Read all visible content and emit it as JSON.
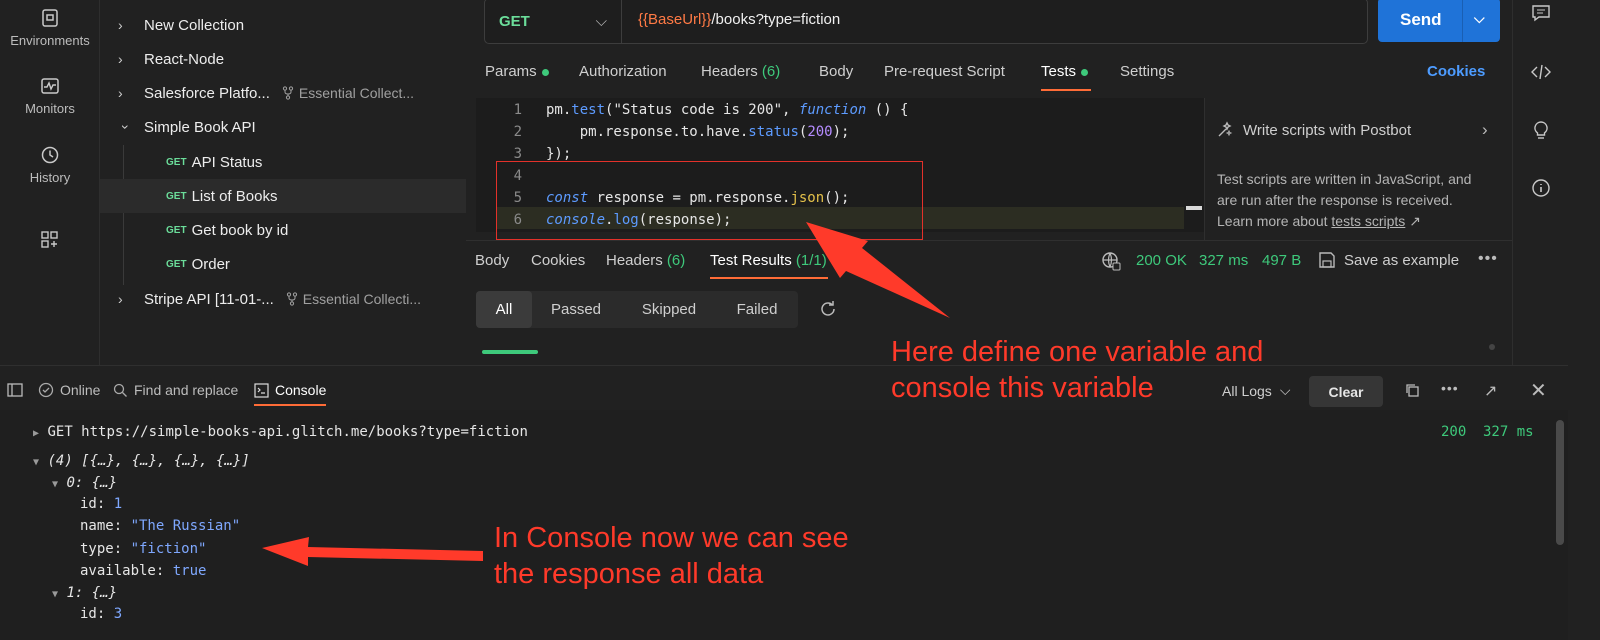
{
  "left_rail": {
    "environments": "Environments",
    "monitors": "Monitors",
    "history": "History"
  },
  "collections": [
    {
      "label": "New Collection",
      "fork": ""
    },
    {
      "label": "React-Node",
      "fork": ""
    },
    {
      "label": "Salesforce Platfo...",
      "fork": "Essential Collect..."
    },
    {
      "label": "Simple Book API",
      "fork": ""
    },
    {
      "label": "Stripe API [11-01-...",
      "fork": "Essential Collecti..."
    }
  ],
  "requests": [
    {
      "method": "GET",
      "label": "API Status"
    },
    {
      "method": "GET",
      "label": "List of Books"
    },
    {
      "method": "GET",
      "label": "Get book by id"
    },
    {
      "method": "GET",
      "label": "Order"
    }
  ],
  "request": {
    "method": "GET",
    "url_var": "{{BaseUrl}}",
    "url_path": "/books?type=fiction",
    "send": "Send"
  },
  "req_tabs": {
    "params": "Params",
    "authorization": "Authorization",
    "headers": "Headers",
    "headers_count": "(6)",
    "body": "Body",
    "prerequest": "Pre-request Script",
    "tests": "Tests",
    "settings": "Settings",
    "cookies": "Cookies"
  },
  "code": {
    "line_numbers": [
      "1",
      "2",
      "3",
      "4",
      "5",
      "6"
    ]
  },
  "postbot": {
    "title": "Write scripts with Postbot",
    "desc1": "Test scripts are written in JavaScript, and",
    "desc2": "are run after the response is received.",
    "desc3": "Learn more about ",
    "link": "tests scripts",
    "link_arrow": "↗"
  },
  "resp_tabs": {
    "body": "Body",
    "cookies": "Cookies",
    "headers": "Headers",
    "headers_count": "(6)",
    "test_results": "Test Results",
    "test_results_count": "(1/1)",
    "status": "200 OK",
    "time": "327 ms",
    "size": "497 B",
    "save": "Save as example"
  },
  "filters": {
    "all": "All",
    "passed": "Passed",
    "skipped": "Skipped",
    "failed": "Failed"
  },
  "console_bar": {
    "online": "Online",
    "find": "Find and replace",
    "console": "Console",
    "all_logs": "All Logs",
    "clear": "Clear"
  },
  "console": {
    "request_line": "GET https://simple-books-api.glitch.me/books?type=fiction",
    "status": "200",
    "time": "327 ms",
    "array_summary": "(4) [{…}, {…}, {…}, {…}]",
    "item0": "0: {…}",
    "id_key": "id: ",
    "id0": "1",
    "name_key": "name: ",
    "name0": "\"The Russian\"",
    "type_key": "type: ",
    "type0": "\"fiction\"",
    "available_key": "available: ",
    "available0": "true",
    "item1": "1: {…}",
    "id1": "3"
  },
  "annotations": {
    "top1": "Here define one variable and",
    "top2": "console this variable",
    "bottom1": "In Console now we can see",
    "bottom2": "the response all data"
  },
  "colors": {
    "accent": "#ff6c37",
    "send": "#1f73d8",
    "get": "#6bdd9a",
    "annotation": "#ff3a2a"
  }
}
